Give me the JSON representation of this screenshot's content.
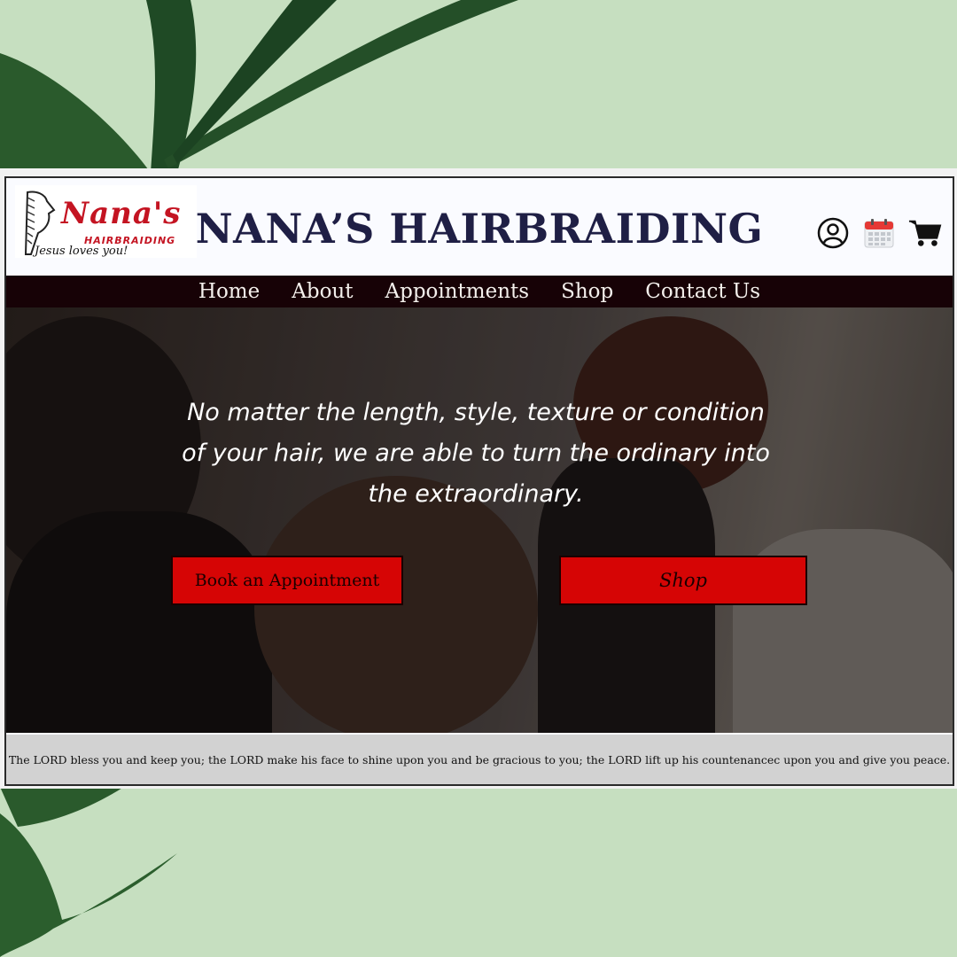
{
  "header": {
    "logo": {
      "script": "Nana's",
      "subtitle": "HAIRBRAIDING",
      "tagline": "Jesus loves you!"
    },
    "title": "NANA’S HAIRBRAIDING",
    "icons": [
      "account-icon",
      "calendar-icon",
      "cart-icon"
    ]
  },
  "nav": {
    "items": [
      {
        "label": "Home"
      },
      {
        "label": "About"
      },
      {
        "label": "Appointments"
      },
      {
        "label": "Shop"
      },
      {
        "label": "Contact Us"
      }
    ]
  },
  "hero": {
    "text": "No matter the length, style, texture or condition of your hair, we are able to turn the ordinary into the extraordinary.",
    "book_button": "Book an Appointment",
    "shop_button": "Shop"
  },
  "footer": {
    "text": "The LORD bless you and keep you; the LORD make his face to shine upon you and be gracious to you; the LORD lift up his countenancec upon you and give you peace."
  },
  "colors": {
    "background": "#c6dfc0",
    "nav_bg": "#170206",
    "button_red": "#d60505",
    "title_navy": "#1f1f45"
  }
}
